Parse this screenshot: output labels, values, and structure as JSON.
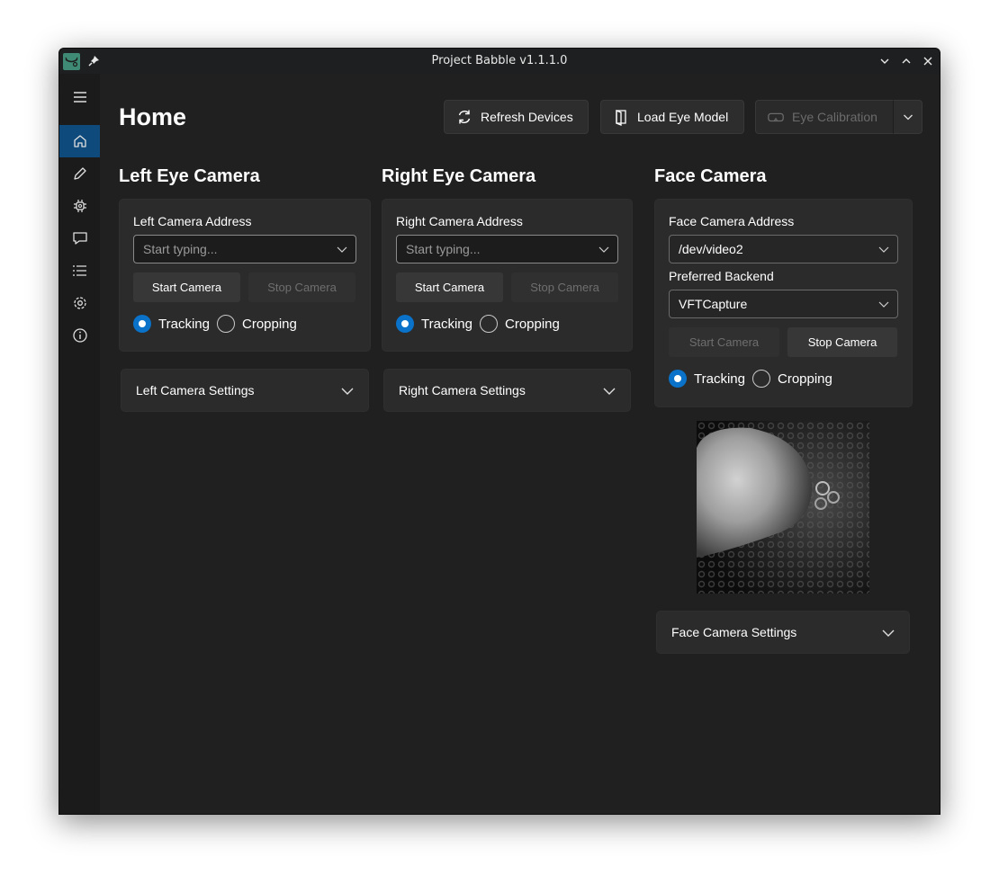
{
  "window": {
    "title": "Project Babble v1.1.1.0"
  },
  "page": {
    "title": "Home"
  },
  "toolbar": {
    "refresh_label": "Refresh Devices",
    "load_model_label": "Load Eye Model",
    "calibration_label": "Eye Calibration"
  },
  "left": {
    "title": "Left Eye Camera",
    "address_label": "Left Camera Address",
    "address_placeholder": "Start typing...",
    "start_label": "Start Camera",
    "stop_label": "Stop Camera",
    "tracking_label": "Tracking",
    "cropping_label": "Cropping",
    "mode": "Tracking",
    "settings_label": "Left Camera Settings"
  },
  "right": {
    "title": "Right Eye Camera",
    "address_label": "Right Camera Address",
    "address_placeholder": "Start typing...",
    "start_label": "Start Camera",
    "stop_label": "Stop Camera",
    "tracking_label": "Tracking",
    "cropping_label": "Cropping",
    "mode": "Tracking",
    "settings_label": "Right Camera Settings"
  },
  "face": {
    "title": "Face Camera",
    "address_label": "Face Camera Address",
    "address_value": "/dev/video2",
    "backend_label": "Preferred Backend",
    "backend_value": "VFTCapture",
    "start_label": "Start Camera",
    "stop_label": "Stop Camera",
    "tracking_label": "Tracking",
    "cropping_label": "Cropping",
    "mode": "Tracking",
    "settings_label": "Face Camera Settings"
  },
  "sidebar": {
    "items": [
      {
        "icon": "home-icon",
        "active": true
      },
      {
        "icon": "pencil-icon",
        "active": false
      },
      {
        "icon": "chip-icon",
        "active": false
      },
      {
        "icon": "chat-icon",
        "active": false
      },
      {
        "icon": "list-icon",
        "active": false
      },
      {
        "icon": "gear-icon",
        "active": false
      },
      {
        "icon": "info-icon",
        "active": false
      }
    ]
  },
  "colors": {
    "accent": "#0a72c9",
    "nav_active": "#0e4a7b",
    "background": "#202020",
    "card": "#2b2b2b"
  }
}
